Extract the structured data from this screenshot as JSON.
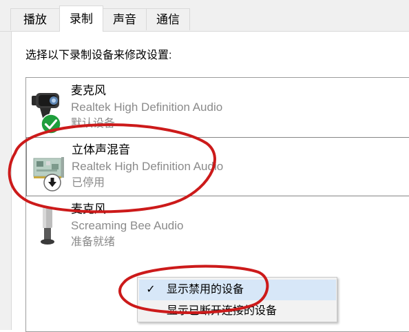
{
  "tabs": [
    {
      "label": "播放"
    },
    {
      "label": "录制"
    },
    {
      "label": "声音"
    },
    {
      "label": "通信"
    }
  ],
  "instruction": "选择以下录制设备来修改设置:",
  "devices": [
    {
      "name": "麦克风",
      "driver": "Realtek High Definition Audio",
      "status": "默认设备",
      "icon": "webcam-microphone-icon",
      "badge": "default-check-badge-icon"
    },
    {
      "name": "立体声混音",
      "driver": "Realtek High Definition Audio",
      "status": "已停用",
      "icon": "sound-card-icon",
      "badge": "disabled-arrow-badge-icon"
    },
    {
      "name": "麦克风",
      "driver": "Screaming Bee Audio",
      "status": "准备就绪",
      "icon": "microphone-icon",
      "badge": ""
    }
  ],
  "context_menu": {
    "items": [
      {
        "label": "显示禁用的设备",
        "checked": true
      },
      {
        "label": "显示已断开连接的设备",
        "checked": false
      }
    ],
    "check_glyph": "✓"
  },
  "colors": {
    "annotation": "#cc1a1a",
    "menu_highlight": "#d7e7f8",
    "check_badge": "#1e9e3c",
    "secondary_text": "#8a8a8a"
  }
}
